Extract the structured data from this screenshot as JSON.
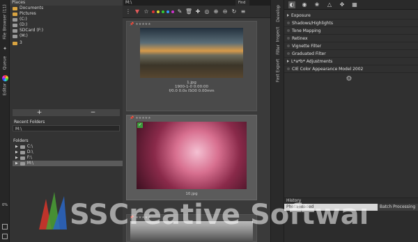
{
  "vtabs": {
    "file_browser": "File Browser (11)",
    "queue": "Queue",
    "editor": "Editor",
    "percent": "0%"
  },
  "places": {
    "header": "Places",
    "items": [
      "Documents",
      "Pictures",
      "(C:)",
      "(D:)",
      "SDCard (F:)",
      "(M:)",
      "3"
    ],
    "add": "+",
    "remove": "−",
    "recent_header": "Recent Folders",
    "recent_value": "M:\\",
    "folders_header": "Folders",
    "folders": [
      "C:\\",
      "D:\\",
      "F:\\",
      "M:\\"
    ]
  },
  "browser": {
    "path": "M:\\",
    "find_label": "Find",
    "thumbs": [
      {
        "file": "1.jpg",
        "date": "1900-1-0 0:00:00",
        "exif": "f/0.0 0.0s ISO0 0.00mm"
      },
      {
        "file": "10.jpg"
      },
      {
        "file": ""
      }
    ]
  },
  "side_tabs": [
    "Develop",
    "Inspect",
    "Filter",
    "Fast Export"
  ],
  "tools": {
    "items": [
      {
        "label": "Exposure"
      },
      {
        "label": "Shadows/Highlights"
      },
      {
        "label": "Tone Mapping"
      },
      {
        "label": "Retinex"
      },
      {
        "label": "Vignette Filter"
      },
      {
        "label": "Graduated Filter"
      },
      {
        "label": "L*a*b* Adjustments"
      },
      {
        "label": "CIE Color Appearance Model 2002"
      }
    ],
    "history_header": "History",
    "history_row": "Photo loaded",
    "batch": "Batch Processing"
  },
  "watermark": "SSCreative Software",
  "colors": {
    "accent": "#e05a5a",
    "folder": "#d9a441"
  }
}
